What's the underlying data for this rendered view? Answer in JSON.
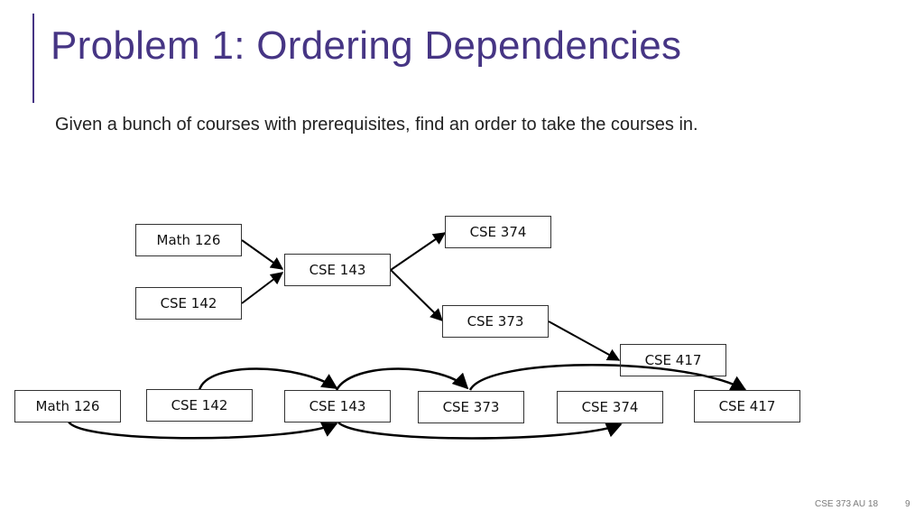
{
  "title": "Problem 1: Ordering Dependencies",
  "subtitle": "Given a bunch of courses with prerequisites, find an order to take the courses in.",
  "graph": {
    "nodes": [
      {
        "id": "math126",
        "label": "Math 126"
      },
      {
        "id": "cse142",
        "label": "CSE 142"
      },
      {
        "id": "cse143",
        "label": "CSE 143"
      },
      {
        "id": "cse374",
        "label": "CSE 374"
      },
      {
        "id": "cse373",
        "label": "CSE 373"
      },
      {
        "id": "cse417",
        "label": "CSE 417"
      }
    ],
    "edges": [
      {
        "from": "math126",
        "to": "cse143"
      },
      {
        "from": "cse142",
        "to": "cse143"
      },
      {
        "from": "cse143",
        "to": "cse374"
      },
      {
        "from": "cse143",
        "to": "cse373"
      },
      {
        "from": "cse373",
        "to": "cse417"
      }
    ]
  },
  "ordering": {
    "nodes": [
      "Math 126",
      "CSE 142",
      "CSE 143",
      "CSE 373",
      "CSE 374",
      "CSE 417"
    ]
  },
  "footer": {
    "course": "CSE 373 AU 18",
    "page": "9"
  }
}
